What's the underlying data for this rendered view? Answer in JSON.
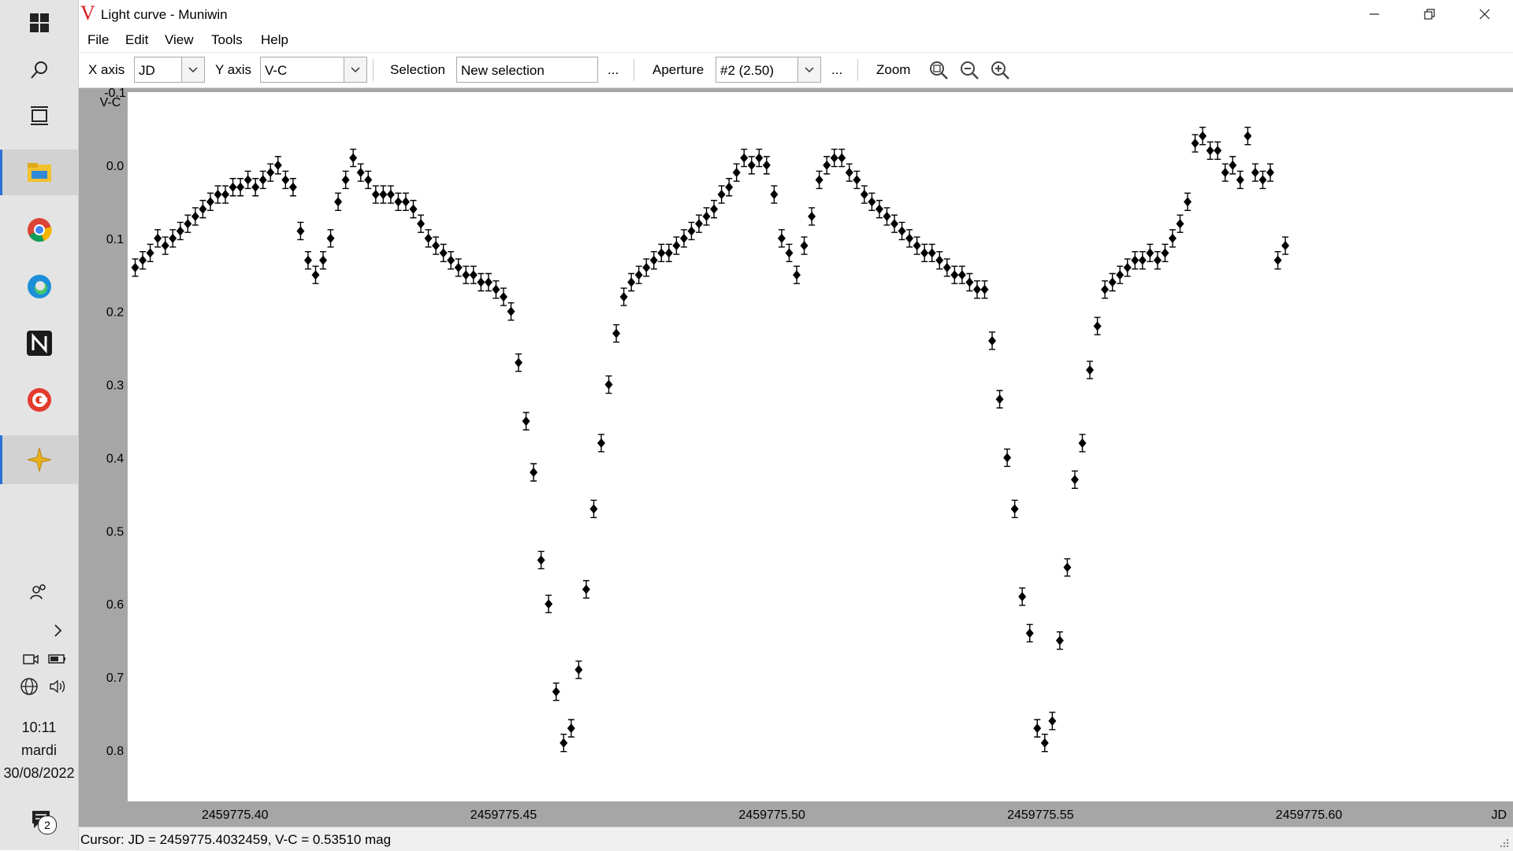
{
  "taskbar": {
    "clock_time": "10:11",
    "clock_day": "mardi",
    "clock_date": "30/08/2022",
    "notification_count": "2"
  },
  "window": {
    "title": "Light curve - Muniwin"
  },
  "menu": {
    "items": [
      "File",
      "Edit",
      "View",
      "Tools",
      "Help"
    ]
  },
  "toolbar": {
    "xaxis_label": "X axis",
    "xaxis_value": "JD",
    "yaxis_label": "Y axis",
    "yaxis_value": "V-C",
    "selection_label": "Selection",
    "selection_value": "New selection",
    "more1": "...",
    "aperture_label": "Aperture",
    "aperture_value": "#2 (2.50)",
    "more2": "...",
    "zoom_label": "Zoom"
  },
  "status": {
    "text": "Cursor: JD = 2459775.4032459, V-C = 0.53510 mag"
  },
  "chart_data": {
    "type": "scatter",
    "ylabel": "V-C",
    "xlabel": "JD",
    "ylim": [
      -0.1,
      0.87
    ],
    "xlim": [
      2459775.38,
      2459775.638
    ],
    "y_inverted": true,
    "y_ticks": [
      "-0.1",
      "0.0",
      "0.1",
      "0.2",
      "0.3",
      "0.4",
      "0.5",
      "0.6",
      "0.7",
      "0.8"
    ],
    "x_ticks": [
      "2459775.40",
      "2459775.45",
      "2459775.50",
      "2459775.55",
      "2459775.60"
    ],
    "y_tick_values": [
      -0.1,
      0.0,
      0.1,
      0.2,
      0.3,
      0.4,
      0.5,
      0.6,
      0.7,
      0.8
    ],
    "x_tick_values": [
      2459775.4,
      2459775.45,
      2459775.5,
      2459775.55,
      2459775.6
    ],
    "marker": "diamond",
    "error_bars": true,
    "points": [
      [
        2459775.3814,
        0.14
      ],
      [
        2459775.3828,
        0.13
      ],
      [
        2459775.3842,
        0.12
      ],
      [
        2459775.3856,
        0.1
      ],
      [
        2459775.387,
        0.11
      ],
      [
        2459775.3884,
        0.1
      ],
      [
        2459775.3898,
        0.09
      ],
      [
        2459775.3912,
        0.08
      ],
      [
        2459775.3926,
        0.07
      ],
      [
        2459775.394,
        0.06
      ],
      [
        2459775.3954,
        0.05
      ],
      [
        2459775.3968,
        0.04
      ],
      [
        2459775.3982,
        0.04
      ],
      [
        2459775.3996,
        0.03
      ],
      [
        2459775.401,
        0.03
      ],
      [
        2459775.4024,
        0.02
      ],
      [
        2459775.4038,
        0.03
      ],
      [
        2459775.4052,
        0.02
      ],
      [
        2459775.4066,
        0.01
      ],
      [
        2459775.408,
        0.0
      ],
      [
        2459775.4094,
        0.02
      ],
      [
        2459775.4108,
        0.03
      ],
      [
        2459775.4122,
        0.09
      ],
      [
        2459775.4136,
        0.13
      ],
      [
        2459775.415,
        0.15
      ],
      [
        2459775.4164,
        0.13
      ],
      [
        2459775.4178,
        0.1
      ],
      [
        2459775.4192,
        0.05
      ],
      [
        2459775.4206,
        0.02
      ],
      [
        2459775.422,
        -0.01
      ],
      [
        2459775.4234,
        0.01
      ],
      [
        2459775.4248,
        0.02
      ],
      [
        2459775.4262,
        0.04
      ],
      [
        2459775.4276,
        0.04
      ],
      [
        2459775.429,
        0.04
      ],
      [
        2459775.4304,
        0.05
      ],
      [
        2459775.4318,
        0.05
      ],
      [
        2459775.4332,
        0.06
      ],
      [
        2459775.4346,
        0.08
      ],
      [
        2459775.436,
        0.1
      ],
      [
        2459775.4374,
        0.11
      ],
      [
        2459775.4388,
        0.12
      ],
      [
        2459775.4402,
        0.13
      ],
      [
        2459775.4416,
        0.14
      ],
      [
        2459775.443,
        0.15
      ],
      [
        2459775.4444,
        0.15
      ],
      [
        2459775.4458,
        0.16
      ],
      [
        2459775.4472,
        0.16
      ],
      [
        2459775.4486,
        0.17
      ],
      [
        2459775.45,
        0.18
      ],
      [
        2459775.4514,
        0.2
      ],
      [
        2459775.4528,
        0.27
      ],
      [
        2459775.4542,
        0.35
      ],
      [
        2459775.4556,
        0.42
      ],
      [
        2459775.457,
        0.54
      ],
      [
        2459775.4584,
        0.6
      ],
      [
        2459775.4598,
        0.72
      ],
      [
        2459775.4612,
        0.79
      ],
      [
        2459775.4626,
        0.77
      ],
      [
        2459775.464,
        0.69
      ],
      [
        2459775.4654,
        0.58
      ],
      [
        2459775.4668,
        0.47
      ],
      [
        2459775.4682,
        0.38
      ],
      [
        2459775.4696,
        0.3
      ],
      [
        2459775.471,
        0.23
      ],
      [
        2459775.4724,
        0.18
      ],
      [
        2459775.4738,
        0.16
      ],
      [
        2459775.4752,
        0.15
      ],
      [
        2459775.4766,
        0.14
      ],
      [
        2459775.478,
        0.13
      ],
      [
        2459775.4794,
        0.12
      ],
      [
        2459775.4808,
        0.12
      ],
      [
        2459775.4822,
        0.11
      ],
      [
        2459775.4836,
        0.1
      ],
      [
        2459775.485,
        0.09
      ],
      [
        2459775.4864,
        0.08
      ],
      [
        2459775.4878,
        0.07
      ],
      [
        2459775.4892,
        0.06
      ],
      [
        2459775.4906,
        0.04
      ],
      [
        2459775.492,
        0.03
      ],
      [
        2459775.4934,
        0.01
      ],
      [
        2459775.4948,
        -0.01
      ],
      [
        2459775.4962,
        0.0
      ],
      [
        2459775.4976,
        -0.01
      ],
      [
        2459775.499,
        0.0
      ],
      [
        2459775.5004,
        0.04
      ],
      [
        2459775.5018,
        0.1
      ],
      [
        2459775.5032,
        0.12
      ],
      [
        2459775.5046,
        0.15
      ],
      [
        2459775.506,
        0.11
      ],
      [
        2459775.5074,
        0.07
      ],
      [
        2459775.5088,
        0.02
      ],
      [
        2459775.5102,
        0.0
      ],
      [
        2459775.5116,
        -0.01
      ],
      [
        2459775.513,
        -0.01
      ],
      [
        2459775.5144,
        0.01
      ],
      [
        2459775.5158,
        0.02
      ],
      [
        2459775.5172,
        0.04
      ],
      [
        2459775.5186,
        0.05
      ],
      [
        2459775.52,
        0.06
      ],
      [
        2459775.5214,
        0.07
      ],
      [
        2459775.5228,
        0.08
      ],
      [
        2459775.5242,
        0.09
      ],
      [
        2459775.5256,
        0.1
      ],
      [
        2459775.527,
        0.11
      ],
      [
        2459775.5284,
        0.12
      ],
      [
        2459775.5298,
        0.12
      ],
      [
        2459775.5312,
        0.13
      ],
      [
        2459775.5326,
        0.14
      ],
      [
        2459775.534,
        0.15
      ],
      [
        2459775.5354,
        0.15
      ],
      [
        2459775.5368,
        0.16
      ],
      [
        2459775.5382,
        0.17
      ],
      [
        2459775.5396,
        0.17
      ],
      [
        2459775.541,
        0.24
      ],
      [
        2459775.5424,
        0.32
      ],
      [
        2459775.5438,
        0.4
      ],
      [
        2459775.5452,
        0.47
      ],
      [
        2459775.5466,
        0.59
      ],
      [
        2459775.548,
        0.64
      ],
      [
        2459775.5494,
        0.77
      ],
      [
        2459775.5508,
        0.79
      ],
      [
        2459775.5522,
        0.76
      ],
      [
        2459775.5536,
        0.65
      ],
      [
        2459775.555,
        0.55
      ],
      [
        2459775.5564,
        0.43
      ],
      [
        2459775.5578,
        0.38
      ],
      [
        2459775.5592,
        0.28
      ],
      [
        2459775.5606,
        0.22
      ],
      [
        2459775.562,
        0.17
      ],
      [
        2459775.5634,
        0.16
      ],
      [
        2459775.5648,
        0.15
      ],
      [
        2459775.5662,
        0.14
      ],
      [
        2459775.5676,
        0.13
      ],
      [
        2459775.569,
        0.13
      ],
      [
        2459775.5704,
        0.12
      ],
      [
        2459775.5718,
        0.13
      ],
      [
        2459775.5732,
        0.12
      ],
      [
        2459775.5746,
        0.1
      ],
      [
        2459775.576,
        0.08
      ],
      [
        2459775.5774,
        0.05
      ],
      [
        2459775.5788,
        -0.03
      ],
      [
        2459775.5802,
        -0.04
      ],
      [
        2459775.5816,
        -0.02
      ],
      [
        2459775.583,
        -0.02
      ],
      [
        2459775.5844,
        0.01
      ],
      [
        2459775.5858,
        0.0
      ],
      [
        2459775.5872,
        0.02
      ],
      [
        2459775.5886,
        -0.04
      ],
      [
        2459775.59,
        0.01
      ],
      [
        2459775.5914,
        0.02
      ],
      [
        2459775.5928,
        0.01
      ],
      [
        2459775.5942,
        0.13
      ],
      [
        2459775.5956,
        0.11
      ]
    ]
  }
}
